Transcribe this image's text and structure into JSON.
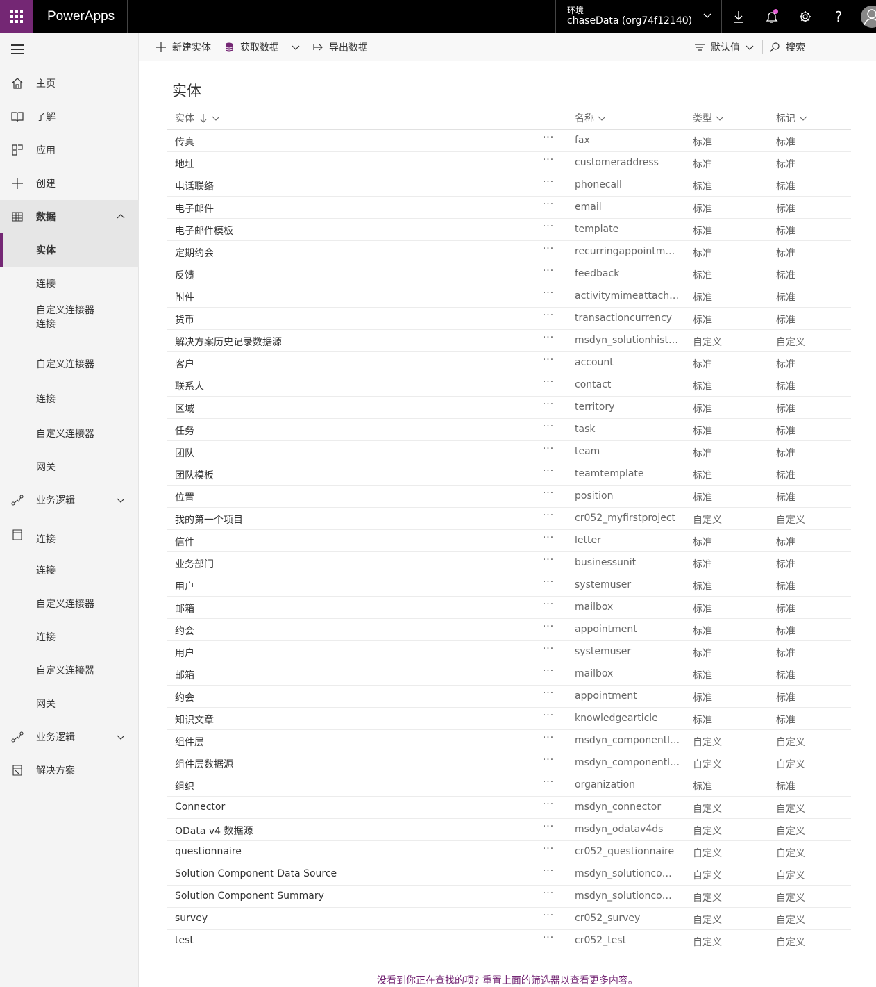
{
  "app": {
    "name": "PowerApps"
  },
  "environment": {
    "label": "环境",
    "value": "chaseData (org74f12140)"
  },
  "topbar": {
    "icons": [
      "download-icon",
      "bell-icon",
      "gear-icon",
      "help-icon",
      "person-icon"
    ],
    "help_glyph": "?"
  },
  "nav": {
    "items": [
      {
        "label": "主页",
        "icon": "home-icon"
      },
      {
        "label": "了解",
        "icon": "book-icon"
      },
      {
        "label": "应用",
        "icon": "apps-icon"
      },
      {
        "label": "创建",
        "icon": "plus-icon"
      },
      {
        "label": "数据",
        "icon": "table-icon"
      },
      {
        "label": "实体"
      },
      {
        "label": "连接"
      },
      {
        "label": "自定义连接器\n连接"
      },
      {
        "label": "自定义连接器"
      },
      {
        "label": "连接"
      },
      {
        "label": "自定义连接器"
      },
      {
        "label": "网关"
      },
      {
        "label": "业务逻辑",
        "icon": "flow-icon"
      },
      {
        "label": "连接",
        "icon": "solution-icon"
      },
      {
        "label": "连接"
      },
      {
        "label": "自定义连接器"
      },
      {
        "label": "连接"
      },
      {
        "label": "自定义连接器"
      },
      {
        "label": "网关"
      },
      {
        "label": "业务逻辑",
        "icon": "flow-icon"
      },
      {
        "label": "解决方案",
        "icon": "solution-icon"
      }
    ]
  },
  "commandbar": {
    "new_entity": "新建实体",
    "get_data": "获取数据",
    "export_data": "导出数据",
    "default_view": "默认值",
    "search": "搜索"
  },
  "page": {
    "title": "实体"
  },
  "table": {
    "columns": {
      "entity": "实体",
      "name": "名称",
      "type": "类型",
      "tag": "标记"
    },
    "more_glyph": "···",
    "rows": [
      {
        "entity": "传真",
        "name": "fax",
        "type": "标准",
        "tag": "标准"
      },
      {
        "entity": "地址",
        "name": "customeraddress",
        "type": "标准",
        "tag": "标准"
      },
      {
        "entity": "电话联络",
        "name": "phonecall",
        "type": "标准",
        "tag": "标准"
      },
      {
        "entity": "电子邮件",
        "name": "email",
        "type": "标准",
        "tag": "标准"
      },
      {
        "entity": "电子邮件模板",
        "name": "template",
        "type": "标准",
        "tag": "标准"
      },
      {
        "entity": "定期约会",
        "name": "recurringappointment...",
        "type": "标准",
        "tag": "标准"
      },
      {
        "entity": "反馈",
        "name": "feedback",
        "type": "标准",
        "tag": "标准"
      },
      {
        "entity": "附件",
        "name": "activitymimeattachment",
        "type": "标准",
        "tag": "标准"
      },
      {
        "entity": "货币",
        "name": "transactioncurrency",
        "type": "标准",
        "tag": "标准"
      },
      {
        "entity": "解决方案历史记录数据源",
        "name": "msdyn_solutionhistory...",
        "type": "自定义",
        "tag": "自定义"
      },
      {
        "entity": "客户",
        "name": "account",
        "type": "标准",
        "tag": "标准"
      },
      {
        "entity": "联系人",
        "name": "contact",
        "type": "标准",
        "tag": "标准"
      },
      {
        "entity": "区域",
        "name": "territory",
        "type": "标准",
        "tag": "标准"
      },
      {
        "entity": "任务",
        "name": "task",
        "type": "标准",
        "tag": "标准"
      },
      {
        "entity": "团队",
        "name": "team",
        "type": "标准",
        "tag": "标准"
      },
      {
        "entity": "团队模板",
        "name": "teamtemplate",
        "type": "标准",
        "tag": "标准"
      },
      {
        "entity": "位置",
        "name": "position",
        "type": "标准",
        "tag": "标准"
      },
      {
        "entity": "我的第一个项目",
        "name": "cr052_myfirstproject",
        "type": "自定义",
        "tag": "自定义"
      },
      {
        "entity": "信件",
        "name": "letter",
        "type": "标准",
        "tag": "标准"
      },
      {
        "entity": "业务部门",
        "name": "businessunit",
        "type": "标准",
        "tag": "标准"
      },
      {
        "entity": "用户",
        "name": "systemuser",
        "type": "标准",
        "tag": "标准"
      },
      {
        "entity": "邮箱",
        "name": "mailbox",
        "type": "标准",
        "tag": "标准"
      },
      {
        "entity": "约会",
        "name": "appointment",
        "type": "标准",
        "tag": "标准"
      },
      {
        "entity": "用户",
        "name": "systemuser",
        "type": "标准",
        "tag": "标准"
      },
      {
        "entity": "邮箱",
        "name": "mailbox",
        "type": "标准",
        "tag": "标准"
      },
      {
        "entity": "约会",
        "name": "appointment",
        "type": "标准",
        "tag": "标准"
      },
      {
        "entity": "知识文章",
        "name": "knowledgearticle",
        "type": "标准",
        "tag": "标准"
      },
      {
        "entity": "组件层",
        "name": "msdyn_componentlayer",
        "type": "自定义",
        "tag": "自定义"
      },
      {
        "entity": "组件层数据源",
        "name": "msdyn_componentlay...",
        "type": "自定义",
        "tag": "自定义"
      },
      {
        "entity": "组织",
        "name": "organization",
        "type": "标准",
        "tag": "标准"
      },
      {
        "entity": "Connector",
        "name": "msdyn_connector",
        "type": "自定义",
        "tag": "自定义"
      },
      {
        "entity": "OData v4 数据源",
        "name": "msdyn_odatav4ds",
        "type": "自定义",
        "tag": "自定义"
      },
      {
        "entity": "questionnaire",
        "name": "cr052_questionnaire",
        "type": "自定义",
        "tag": "自定义"
      },
      {
        "entity": "Solution Component Data Source",
        "name": "msdyn_solutioncompo...",
        "type": "自定义",
        "tag": "自定义"
      },
      {
        "entity": "Solution Component Summary",
        "name": "msdyn_solutioncompo...",
        "type": "自定义",
        "tag": "自定义"
      },
      {
        "entity": "survey",
        "name": "cr052_survey",
        "type": "自定义",
        "tag": "自定义"
      },
      {
        "entity": "test",
        "name": "cr052_test",
        "type": "自定义",
        "tag": "自定义"
      }
    ]
  },
  "footer": {
    "message": "没看到你正在查找的项? 重置上面的筛选器以查看更多内容。"
  },
  "colors": {
    "brand": "#742774",
    "topbar": "#000000",
    "nav_bg": "#f4f4f4",
    "notification_dot": "#e65fd5"
  }
}
